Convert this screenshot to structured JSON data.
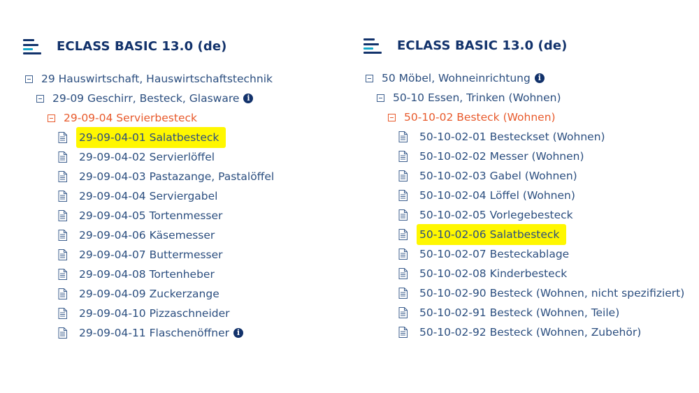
{
  "left": {
    "title": "ECLASS BASIC 13.0 (de)",
    "rows": [
      {
        "text": "29 Hauswirtschaft, Hauswirtschaftstechnik"
      },
      {
        "text": "29-09 Geschirr, Besteck, Glasware"
      },
      {
        "text": "29-09-04 Servierbesteck"
      },
      {
        "text": "29-09-04-01 Salatbesteck"
      },
      {
        "text": "29-09-04-02 Servierlöffel"
      },
      {
        "text": "29-09-04-03 Pastazange, Pastalöffel"
      },
      {
        "text": "29-09-04-04 Serviergabel"
      },
      {
        "text": "29-09-04-05 Tortenmesser"
      },
      {
        "text": "29-09-04-06 Käsemesser"
      },
      {
        "text": "29-09-04-07 Buttermesser"
      },
      {
        "text": "29-09-04-08 Tortenheber"
      },
      {
        "text": "29-09-04-09 Zuckerzange"
      },
      {
        "text": "29-09-04-10 Pizzaschneider"
      },
      {
        "text": "29-09-04-11 Flaschenöffner"
      }
    ]
  },
  "right": {
    "title": "ECLASS BASIC 13.0 (de)",
    "rows": [
      {
        "text": "50 Möbel, Wohneinrichtung"
      },
      {
        "text": "50-10 Essen, Trinken (Wohnen)"
      },
      {
        "text": "50-10-02 Besteck (Wohnen)"
      },
      {
        "text": "50-10-02-01 Besteckset (Wohnen)"
      },
      {
        "text": "50-10-02-02 Messer (Wohnen)"
      },
      {
        "text": "50-10-02-03 Gabel (Wohnen)"
      },
      {
        "text": "50-10-02-04 Löffel (Wohnen)"
      },
      {
        "text": "50-10-02-05 Vorlegebesteck"
      },
      {
        "text": "50-10-02-06 Salatbesteck"
      },
      {
        "text": "50-10-02-07 Besteckablage"
      },
      {
        "text": "50-10-02-08 Kinderbesteck"
      },
      {
        "text": "50-10-02-90 Besteck (Wohnen, nicht spezifiziert)"
      },
      {
        "text": "50-10-02-91 Besteck (Wohnen, Teile)"
      },
      {
        "text": "50-10-02-92 Besteck (Wohnen, Zubehör)"
      }
    ]
  },
  "colors": {
    "text": "#2b4e7f",
    "title": "#12326b",
    "selected_branch": "#e85a2c",
    "highlight": "#fff700",
    "logo_accent": "#14a7c9"
  },
  "info_icon_glyph": "i"
}
